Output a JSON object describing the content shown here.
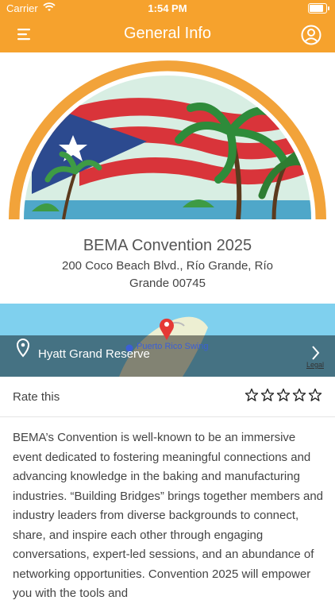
{
  "status_bar": {
    "carrier": "Carrier",
    "time": "1:54 PM"
  },
  "header": {
    "title": "General Info"
  },
  "event": {
    "name": "BEMA Convention 2025",
    "address": "200 Coco Beach Blvd., Río Grande, Río Grande 00745"
  },
  "map": {
    "location_label": "Hyatt Grand Reserve",
    "poi_label": "Puerto Rico Swing",
    "legal": "Legal"
  },
  "rating": {
    "label": "Rate this",
    "max_stars": 5,
    "value": 0
  },
  "description": "BEMA’s Convention is well-known to be an immersive event dedicated to fostering meaningful connections and advancing knowledge in the baking and manufacturing industries. “Building Bridges” brings together members and industry leaders from diverse backgrounds to connect, share, and inspire each other through engaging conversations, expert-led sessions, and an abundance of networking opportunities. Convention 2025 will empower you with the tools and",
  "colors": {
    "header": "#F6A22D",
    "flag_red": "#D9343A",
    "flag_blue": "#2C4A8F",
    "pin": "#E53935"
  }
}
